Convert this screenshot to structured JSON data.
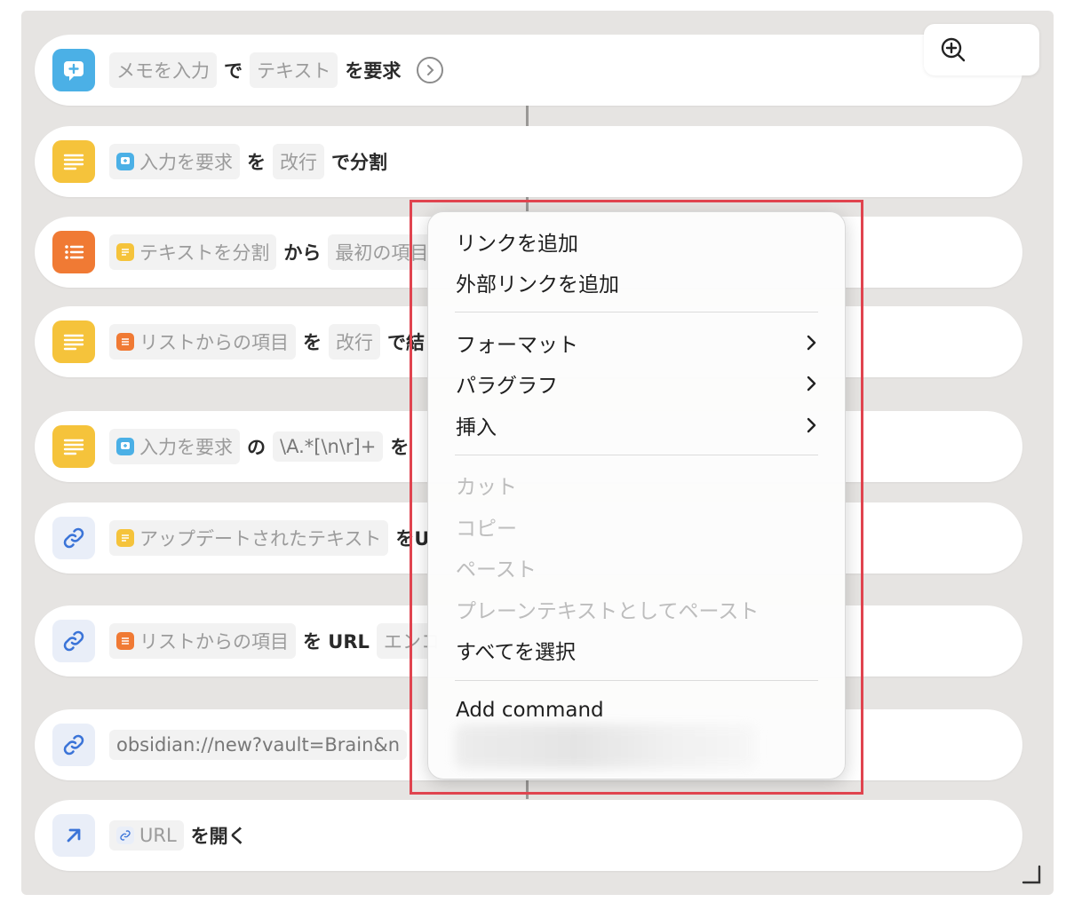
{
  "actions": [
    {
      "tokens": [
        "メモを入力",
        "テキスト"
      ],
      "texts": [
        "で",
        "を要求"
      ]
    },
    {
      "tokens": [
        "入力を要求",
        "改行"
      ],
      "texts": [
        "を",
        "で分割"
      ]
    },
    {
      "tokens": [
        "テキストを分割",
        "最初の項目"
      ],
      "texts": [
        "から"
      ]
    },
    {
      "tokens": [
        "リストからの項目",
        "改行"
      ],
      "texts": [
        "を",
        "で結"
      ]
    },
    {
      "tokens": [
        "入力を要求",
        "\\A.*[\\n\\r]+"
      ],
      "texts": [
        "の",
        "を"
      ]
    },
    {
      "tokens": [
        "アップデートされたテキスト"
      ],
      "texts": [
        "をU"
      ]
    },
    {
      "tokens": [
        "リストからの項目",
        "エンコ"
      ],
      "texts": [
        "を URL"
      ]
    },
    {
      "tokens": [
        "obsidian://new?vault=Brain&n"
      ],
      "texts": []
    },
    {
      "tokens": [
        "URL"
      ],
      "texts": [
        "を開く"
      ]
    }
  ],
  "menu": {
    "group1": [
      "リンクを追加",
      "外部リンクを追加"
    ],
    "group2": [
      "フォーマット",
      "パラグラフ",
      "挿入"
    ],
    "group3_disabled": [
      "カット",
      "コピー",
      "ペースト",
      "プレーンテキストとしてペースト"
    ],
    "select_all": "すべてを選択",
    "add_command": "Add command"
  },
  "colors": {
    "highlight": "#e0444f",
    "icon_blue": "#4bb0e6",
    "icon_yellow": "#f5c33b",
    "icon_orange": "#f07a34",
    "link_blue": "#3b74d8"
  },
  "icons": {
    "zoom": "zoom-in-icon",
    "resize": "resize-corner-icon"
  }
}
